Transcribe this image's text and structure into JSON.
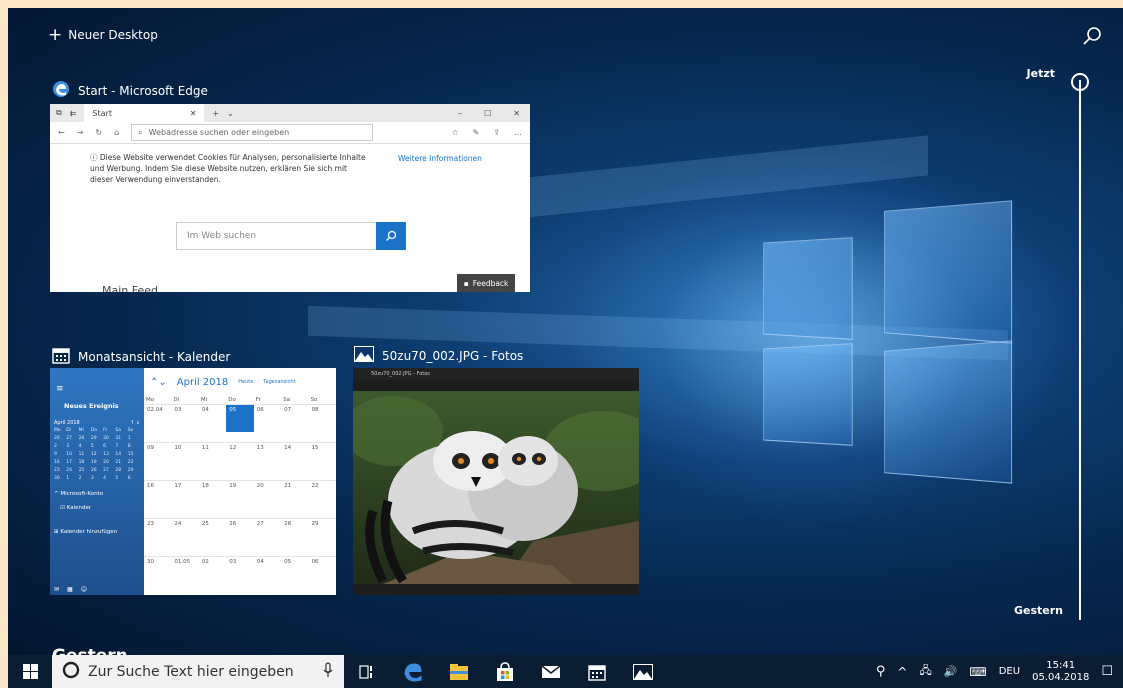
{
  "task_view": {
    "new_desktop_label": "Neuer Desktop",
    "timeline": {
      "now_label": "Jetzt",
      "yesterday_label": "Gestern"
    },
    "section_heading": "Gestern"
  },
  "windows": {
    "edge": {
      "title": "Start - Microsoft Edge",
      "tab_label": "Start",
      "address_placeholder": "Webadresse suchen oder eingeben",
      "cookie_text": "Diese Website verwendet Cookies für Analysen, personalisierte Inhalte und Werbung. Indem Sie diese Website nutzen, erklären Sie sich mit dieser Verwendung einverstanden.",
      "cookie_link": "Weitere Informationen",
      "search_placeholder": "Im Web suchen",
      "feedback_label": "Feedback",
      "main_feed_label": "Main Feed"
    },
    "calendar": {
      "title": "Monatsansicht - Kalender",
      "new_event": "Neues Ereignis",
      "mini_month": "April 2018",
      "month_label": "April 2018",
      "today_button": "Heute",
      "day_view": "Tagesansicht",
      "account_section": "Microsoft-Konto",
      "calendar_item": "Kalender",
      "add_calendar": "Kalender hinzufügen",
      "weekdays": [
        "Mo",
        "Di",
        "Mi",
        "Do",
        "Fr",
        "Sa",
        "So"
      ],
      "days": [
        "02.04",
        "03",
        "04",
        "05",
        "06",
        "07",
        "08",
        "09",
        "10",
        "11",
        "12",
        "13",
        "14",
        "15",
        "16",
        "17",
        "18",
        "19",
        "20",
        "21",
        "22",
        "23",
        "24",
        "25",
        "26",
        "27",
        "28",
        "29",
        "30",
        "01.05",
        "02",
        "03",
        "04",
        "05",
        "06"
      ],
      "mini_weekdays": [
        "Mo",
        "Di",
        "Mi",
        "Do",
        "Fr",
        "Sa",
        "So"
      ],
      "mini_days": [
        "26",
        "27",
        "28",
        "29",
        "30",
        "31",
        "1",
        "2",
        "3",
        "4",
        "5",
        "6",
        "7",
        "8",
        "9",
        "10",
        "11",
        "12",
        "13",
        "14",
        "15",
        "16",
        "17",
        "18",
        "19",
        "20",
        "21",
        "22",
        "23",
        "24",
        "25",
        "26",
        "27",
        "28",
        "29",
        "30",
        "1",
        "2",
        "3",
        "4",
        "5",
        "6"
      ]
    },
    "photos": {
      "title": "50zu70_002.JPG - Fotos",
      "bar_label": "50zu70_002.JPG - Fotos"
    }
  },
  "taskbar": {
    "search_placeholder": "Zur Suche Text hier eingeben",
    "language": "DEU",
    "time": "15:41",
    "date": "05.04.2018"
  },
  "colors": {
    "accent": "#1a73c8",
    "taskbar": "#0b1d33",
    "edge_blue": "#3c8ee0",
    "files_yellow": "#f3c33c"
  },
  "icons": [
    "plus-icon",
    "search-icon",
    "edge-icon",
    "calendar-icon",
    "photos-icon",
    "windows-start-icon",
    "cortana-icon",
    "microphone-icon",
    "task-view-icon",
    "file-explorer-icon",
    "store-icon",
    "mail-icon",
    "people-icon",
    "chevron-up-icon",
    "network-icon",
    "volume-icon",
    "keyboard-icon",
    "action-center-icon"
  ]
}
